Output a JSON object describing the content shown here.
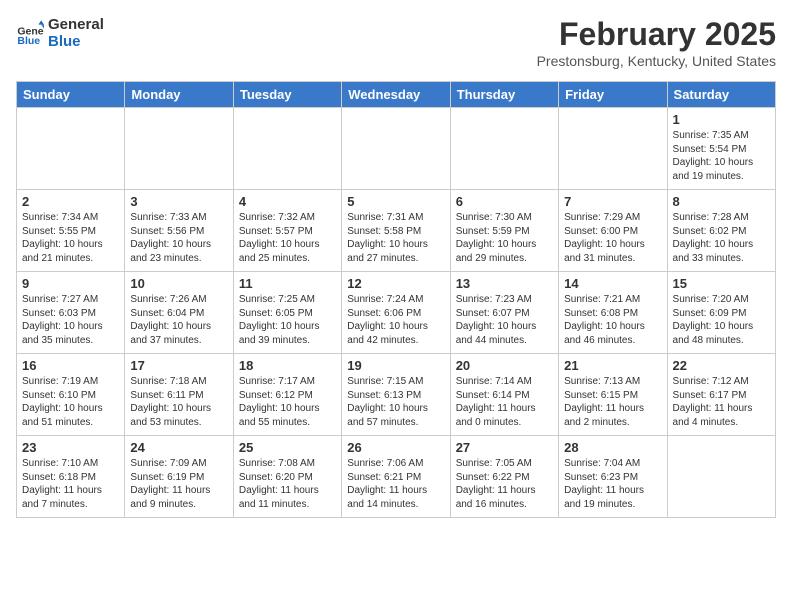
{
  "logo": {
    "line1": "General",
    "line2": "Blue"
  },
  "title": "February 2025",
  "location": "Prestonsburg, Kentucky, United States",
  "days_of_week": [
    "Sunday",
    "Monday",
    "Tuesday",
    "Wednesday",
    "Thursday",
    "Friday",
    "Saturday"
  ],
  "weeks": [
    [
      null,
      null,
      null,
      null,
      null,
      null,
      {
        "day": "1",
        "sunrise": "7:35 AM",
        "sunset": "5:54 PM",
        "daylight": "10 hours and 19 minutes."
      }
    ],
    [
      {
        "day": "2",
        "sunrise": "7:34 AM",
        "sunset": "5:55 PM",
        "daylight": "10 hours and 21 minutes."
      },
      {
        "day": "3",
        "sunrise": "7:33 AM",
        "sunset": "5:56 PM",
        "daylight": "10 hours and 23 minutes."
      },
      {
        "day": "4",
        "sunrise": "7:32 AM",
        "sunset": "5:57 PM",
        "daylight": "10 hours and 25 minutes."
      },
      {
        "day": "5",
        "sunrise": "7:31 AM",
        "sunset": "5:58 PM",
        "daylight": "10 hours and 27 minutes."
      },
      {
        "day": "6",
        "sunrise": "7:30 AM",
        "sunset": "5:59 PM",
        "daylight": "10 hours and 29 minutes."
      },
      {
        "day": "7",
        "sunrise": "7:29 AM",
        "sunset": "6:00 PM",
        "daylight": "10 hours and 31 minutes."
      },
      {
        "day": "8",
        "sunrise": "7:28 AM",
        "sunset": "6:02 PM",
        "daylight": "10 hours and 33 minutes."
      }
    ],
    [
      {
        "day": "9",
        "sunrise": "7:27 AM",
        "sunset": "6:03 PM",
        "daylight": "10 hours and 35 minutes."
      },
      {
        "day": "10",
        "sunrise": "7:26 AM",
        "sunset": "6:04 PM",
        "daylight": "10 hours and 37 minutes."
      },
      {
        "day": "11",
        "sunrise": "7:25 AM",
        "sunset": "6:05 PM",
        "daylight": "10 hours and 39 minutes."
      },
      {
        "day": "12",
        "sunrise": "7:24 AM",
        "sunset": "6:06 PM",
        "daylight": "10 hours and 42 minutes."
      },
      {
        "day": "13",
        "sunrise": "7:23 AM",
        "sunset": "6:07 PM",
        "daylight": "10 hours and 44 minutes."
      },
      {
        "day": "14",
        "sunrise": "7:21 AM",
        "sunset": "6:08 PM",
        "daylight": "10 hours and 46 minutes."
      },
      {
        "day": "15",
        "sunrise": "7:20 AM",
        "sunset": "6:09 PM",
        "daylight": "10 hours and 48 minutes."
      }
    ],
    [
      {
        "day": "16",
        "sunrise": "7:19 AM",
        "sunset": "6:10 PM",
        "daylight": "10 hours and 51 minutes."
      },
      {
        "day": "17",
        "sunrise": "7:18 AM",
        "sunset": "6:11 PM",
        "daylight": "10 hours and 53 minutes."
      },
      {
        "day": "18",
        "sunrise": "7:17 AM",
        "sunset": "6:12 PM",
        "daylight": "10 hours and 55 minutes."
      },
      {
        "day": "19",
        "sunrise": "7:15 AM",
        "sunset": "6:13 PM",
        "daylight": "10 hours and 57 minutes."
      },
      {
        "day": "20",
        "sunrise": "7:14 AM",
        "sunset": "6:14 PM",
        "daylight": "11 hours and 0 minutes."
      },
      {
        "day": "21",
        "sunrise": "7:13 AM",
        "sunset": "6:15 PM",
        "daylight": "11 hours and 2 minutes."
      },
      {
        "day": "22",
        "sunrise": "7:12 AM",
        "sunset": "6:17 PM",
        "daylight": "11 hours and 4 minutes."
      }
    ],
    [
      {
        "day": "23",
        "sunrise": "7:10 AM",
        "sunset": "6:18 PM",
        "daylight": "11 hours and 7 minutes."
      },
      {
        "day": "24",
        "sunrise": "7:09 AM",
        "sunset": "6:19 PM",
        "daylight": "11 hours and 9 minutes."
      },
      {
        "day": "25",
        "sunrise": "7:08 AM",
        "sunset": "6:20 PM",
        "daylight": "11 hours and 11 minutes."
      },
      {
        "day": "26",
        "sunrise": "7:06 AM",
        "sunset": "6:21 PM",
        "daylight": "11 hours and 14 minutes."
      },
      {
        "day": "27",
        "sunrise": "7:05 AM",
        "sunset": "6:22 PM",
        "daylight": "11 hours and 16 minutes."
      },
      {
        "day": "28",
        "sunrise": "7:04 AM",
        "sunset": "6:23 PM",
        "daylight": "11 hours and 19 minutes."
      },
      null
    ]
  ]
}
